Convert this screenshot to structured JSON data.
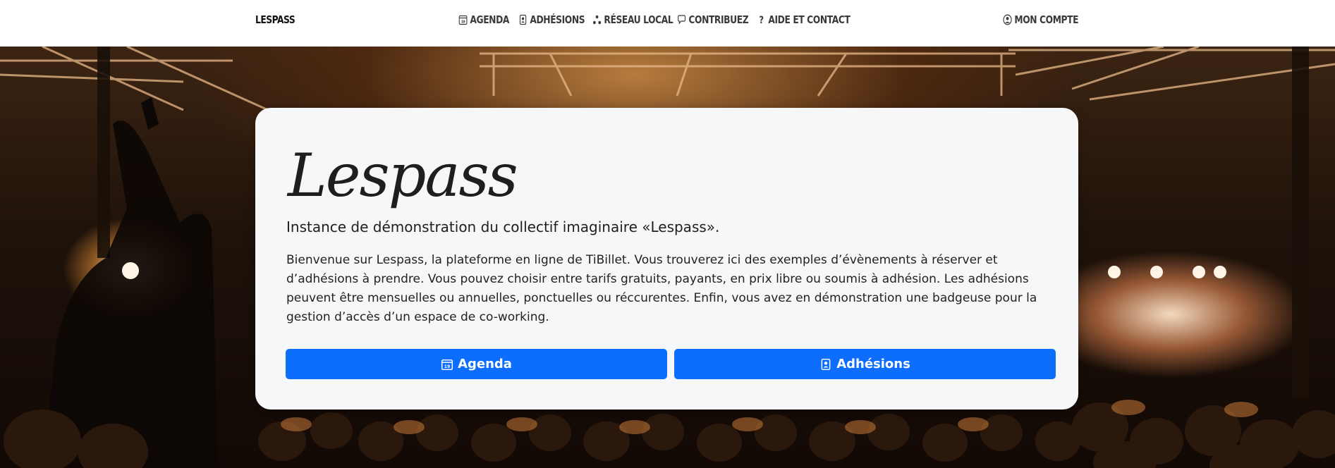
{
  "navbar": {
    "brand": "LESPASS",
    "items": [
      {
        "label": "AGENDA",
        "icon": "calendar-icon"
      },
      {
        "label": "ADHÉSIONS",
        "icon": "member-card-icon"
      },
      {
        "label": "RÉSEAU LOCAL",
        "icon": "network-icon"
      },
      {
        "label": "CONTRIBUEZ",
        "icon": "chat-icon"
      },
      {
        "label": "AIDE ET CONTACT",
        "icon": "question-icon"
      }
    ],
    "account": {
      "label": "MON COMPTE",
      "icon": "user-circle-icon"
    }
  },
  "hero": {
    "title": "Lespass",
    "subtitle": "Instance de démonstration du collectif imaginaire «Lespass».",
    "description": "Bienvenue sur Lespass, la plateforme en ligne de TiBillet. Vous trouverez ici des exemples d’évènements à réserver et d’adhésions à prendre. Vous pouvez choisir entre tarifs gratuits, payants, en prix libre ou soumis à adhésion. Les adhésions peuvent être mensuelles ou annuelles, ponctuelles ou réccurentes. Enfin, vous avez en démonstration une badgeuse pour la gestion d’accès d’un espace de co-working.",
    "buttons": [
      {
        "label": "Agenda",
        "icon": "calendar-icon"
      },
      {
        "label": "Adhésions",
        "icon": "member-card-icon"
      }
    ]
  },
  "colors": {
    "accent": "#0d6efd",
    "card_background": "#f6f7f9",
    "nav_text": "#3a3a3a"
  }
}
